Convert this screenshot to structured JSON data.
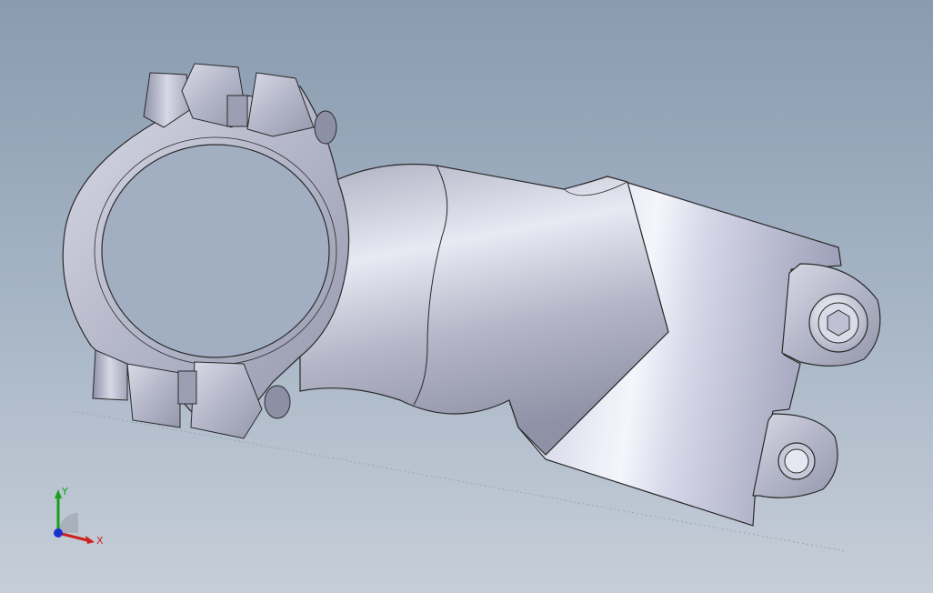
{
  "viewport": {
    "background_top": "#8a9bb0",
    "background_bottom": "#c6ced8"
  },
  "model": {
    "part_color": "#c9cbdc",
    "edge_color": "#2a2a2a",
    "highlight_color": "#f1f2fb"
  },
  "triad": {
    "x_label": "X",
    "y_label": "Y",
    "x_color": "#d11f1f",
    "y_color": "#16a01c",
    "z_color": "#1b32d1"
  }
}
